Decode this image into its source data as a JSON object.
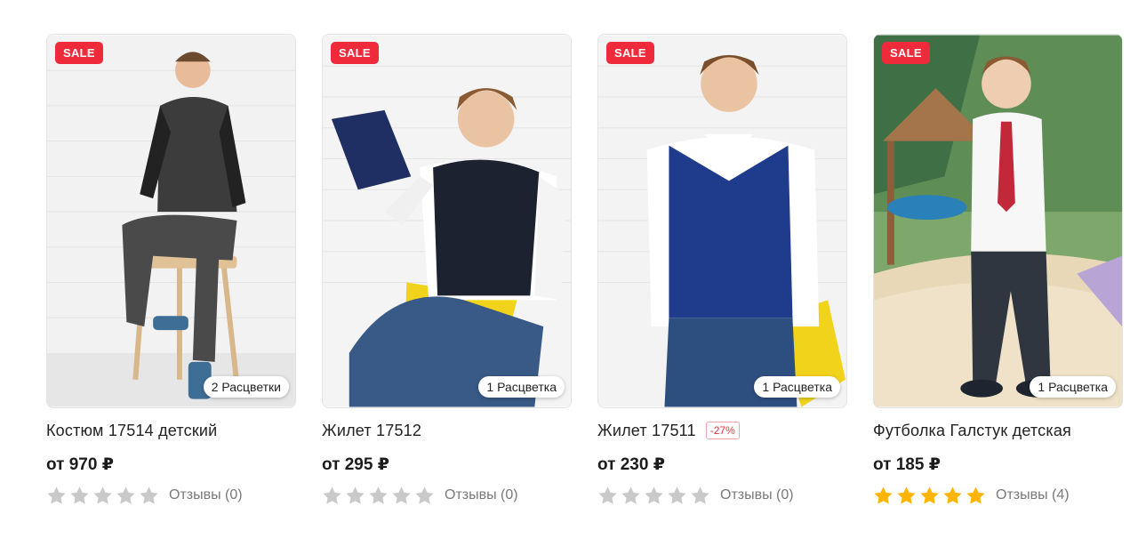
{
  "colors": {
    "sale": "#ef2b3b",
    "star_on": "#ffb400",
    "star_off": "#c9c9c9",
    "discount": "#e8333f"
  },
  "icons": {
    "star": "star-icon"
  },
  "products": [
    {
      "badge": "SALE",
      "colors_label": "2 Расцветки",
      "title": "Костюм 17514 детский",
      "discount": "",
      "price": "от 970 ₽",
      "rating": 0,
      "reviews": "Отзывы (0)"
    },
    {
      "badge": "SALE",
      "colors_label": "1 Расцветка",
      "title": "Жилет 17512",
      "discount": "",
      "price": "от 295 ₽",
      "rating": 0,
      "reviews": "Отзывы (0)"
    },
    {
      "badge": "SALE",
      "colors_label": "1 Расцветка",
      "title": "Жилет 17511",
      "discount": "-27%",
      "price": "от 230 ₽",
      "rating": 0,
      "reviews": "Отзывы (0)"
    },
    {
      "badge": "SALE",
      "colors_label": "1 Расцветка",
      "title": "Футболка Галстук детская",
      "discount": "",
      "price": "от 185 ₽",
      "rating": 5,
      "reviews": "Отзывы (4)"
    }
  ]
}
